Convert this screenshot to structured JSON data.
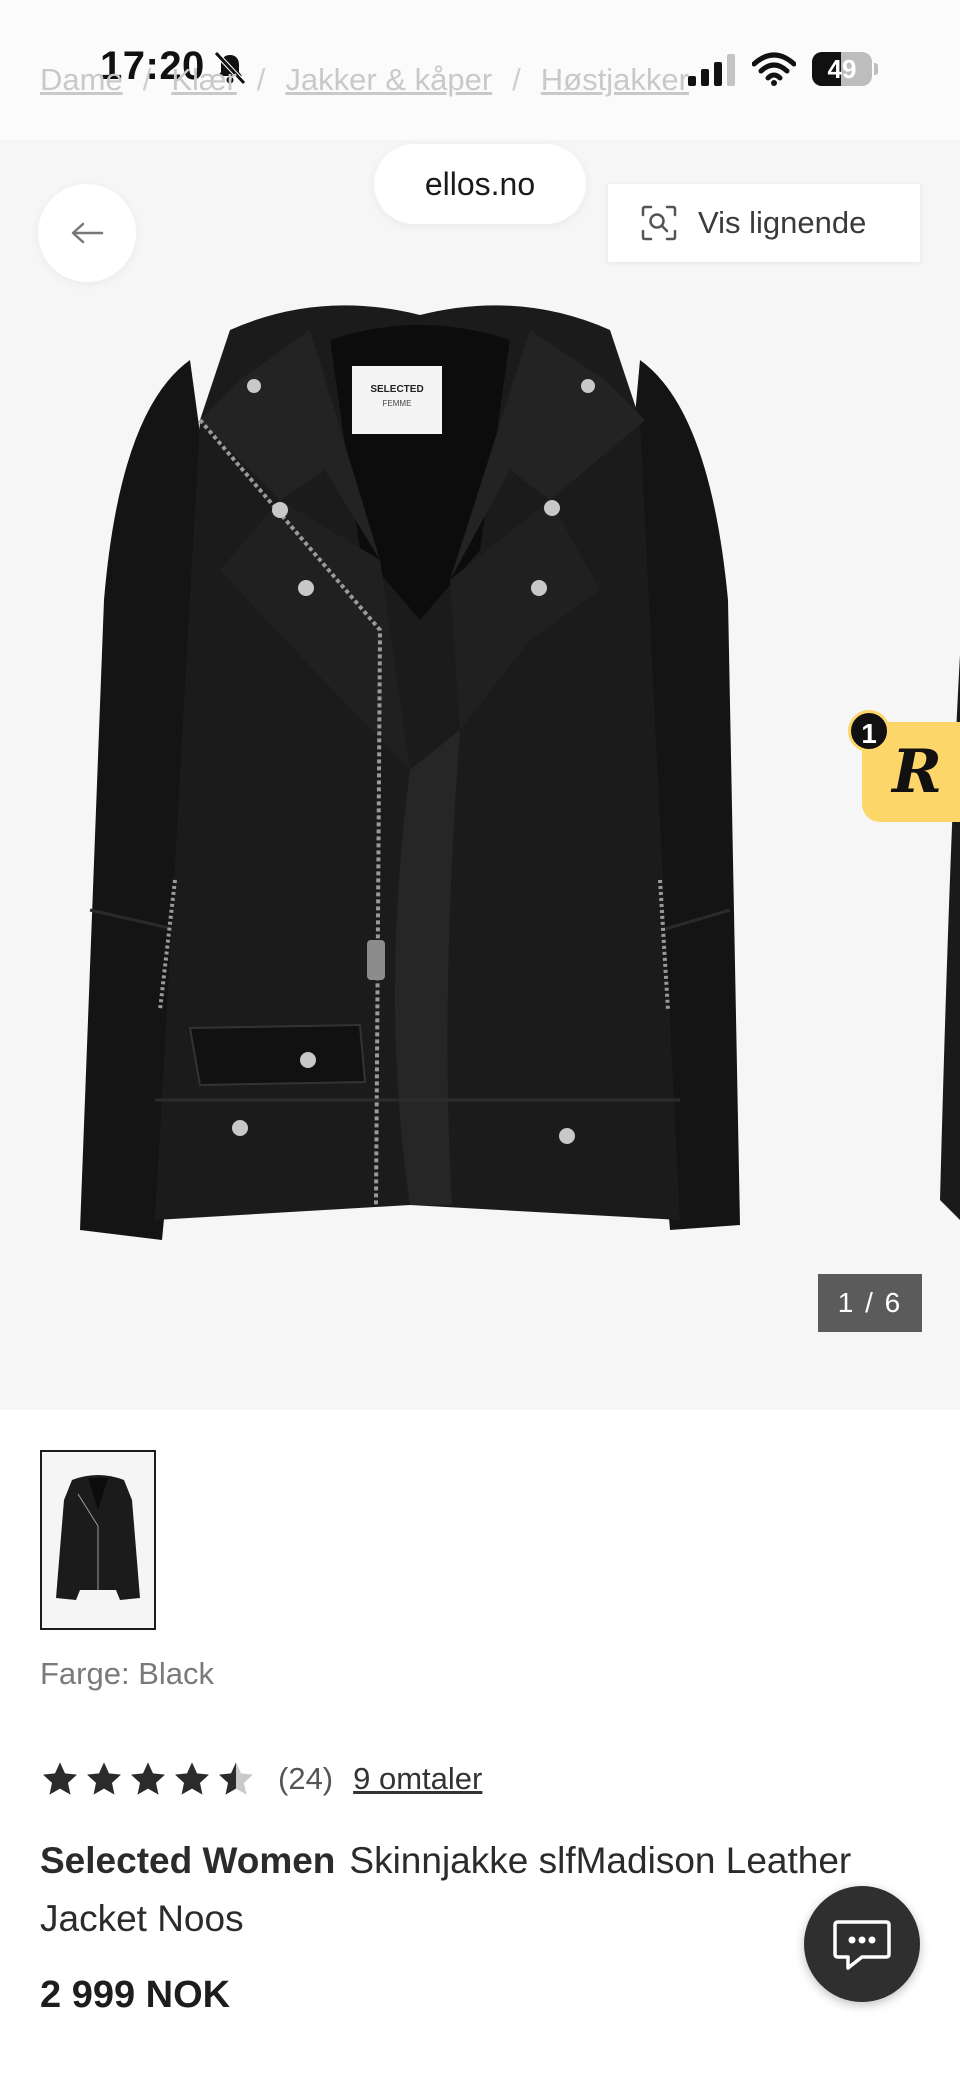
{
  "status_bar": {
    "time": "17:20",
    "battery_level": "49",
    "battery_fraction": 0.49
  },
  "breadcrumb": [
    "Dame",
    "Klær",
    "Jakker & kåper",
    "Høstjakker"
  ],
  "browser": {
    "site": "ellos.no"
  },
  "gallery": {
    "back_icon": "arrow-left-icon",
    "similar_label": "Vis lignende",
    "similar_icon": "visual-search-icon",
    "counter": "1 / 6",
    "reward_count": "1",
    "reward_letter": "R",
    "reward_color": "#fdd66a"
  },
  "product": {
    "color_label": "Farge: Black",
    "rating": 4.5,
    "review_count": "(24)",
    "reviews_link": "9 omtaler",
    "brand": "Selected Women",
    "name": "Skinnjakke slfMadison Leather Jacket Noos",
    "price": "2 999 NOK"
  },
  "chat": {
    "icon": "chat-bubble-icon"
  }
}
